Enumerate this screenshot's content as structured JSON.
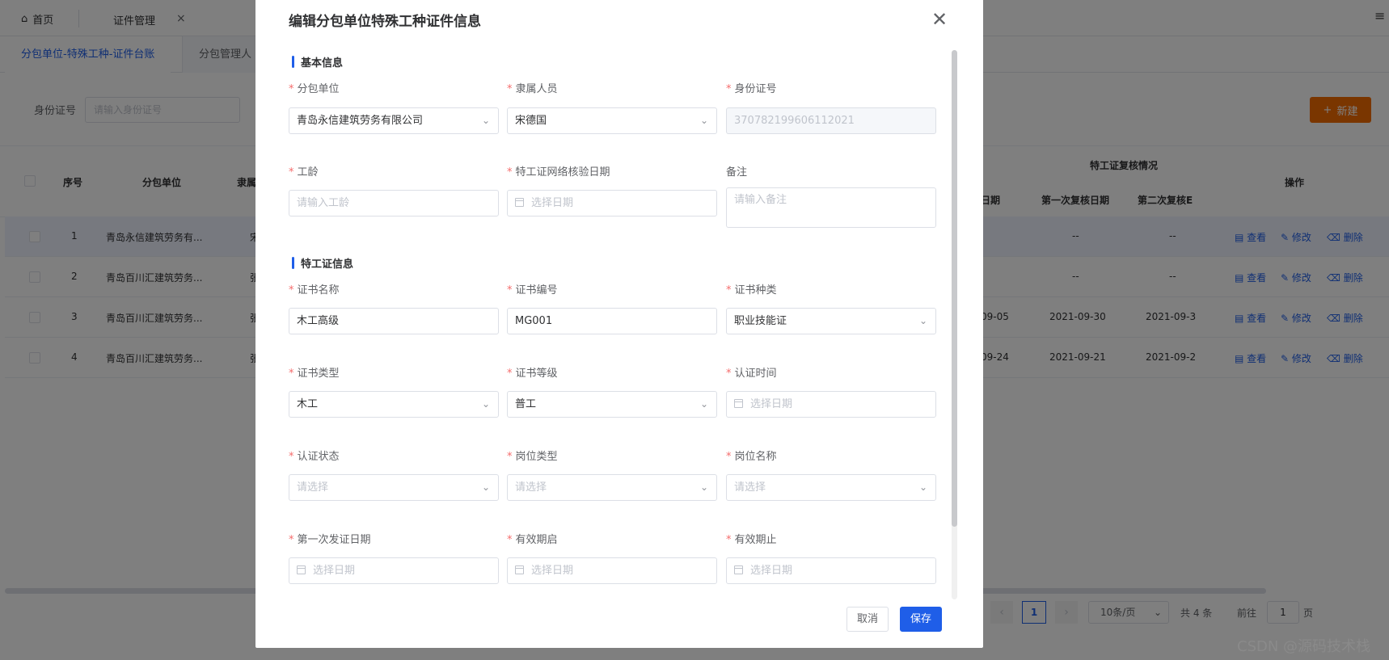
{
  "tabs": {
    "home": "首页",
    "cert_mgmt": "证件管理"
  },
  "subtabs": [
    "分包单位-特殊工种-证件台账",
    "分包管理人"
  ],
  "filter": {
    "label": "身份证号",
    "placeholder": "请输入身份证号"
  },
  "new_button": "新建",
  "table": {
    "headers": {
      "index": "序号",
      "unit": "分包单位",
      "person": "隶属",
      "review_group": "特工证复核情况",
      "date_tail": "日期",
      "first_review": "第一次复核日期",
      "second_review": "第二次复核E",
      "ops": "操作"
    },
    "rows": [
      {
        "index": "1",
        "unit": "青岛永信建筑劳务有...",
        "person": "宋",
        "date": "",
        "first": "--",
        "second": "--"
      },
      {
        "index": "2",
        "unit": "青岛百川汇建筑劳务...",
        "person": "张",
        "date": "",
        "first": "--",
        "second": "--"
      },
      {
        "index": "3",
        "unit": "青岛百川汇建筑劳务...",
        "person": "张",
        "date": "09-05",
        "first": "2021-09-30",
        "second": "2021-09-3"
      },
      {
        "index": "4",
        "unit": "青岛百川汇建筑劳务...",
        "person": "张",
        "date": "09-24",
        "first": "2021-09-21",
        "second": "2021-09-2"
      }
    ],
    "ops": {
      "view": "查看",
      "edit": "修改",
      "delete": "删除"
    }
  },
  "pager": {
    "page": "1",
    "size": "10条/页",
    "total": "共 4 条",
    "goto": "前往",
    "goto_value": "1",
    "page_unit": "页"
  },
  "watermark": "CSDN @源码技术栈",
  "dialog": {
    "title": "编辑分包单位特殊工种证件信息",
    "section_basic": "基本信息",
    "section_cert": "特工证信息",
    "fields": {
      "unit": {
        "label": "分包单位",
        "value": "青岛永信建筑劳务有限公司"
      },
      "person": {
        "label": "隶属人员",
        "value": "宋德国"
      },
      "idcard": {
        "label": "身份证号",
        "value": "370782199606112021"
      },
      "seniority": {
        "label": "工龄",
        "placeholder": "请输入工龄"
      },
      "verify_date": {
        "label": "特工证网络核验日期",
        "placeholder": "选择日期"
      },
      "remark": {
        "label": "备注",
        "placeholder": "请输入备注"
      },
      "cert_name": {
        "label": "证书名称",
        "value": "木工高级"
      },
      "cert_no": {
        "label": "证书编号",
        "value": "MG001"
      },
      "cert_kind": {
        "label": "证书种类",
        "value": "职业技能证"
      },
      "cert_type": {
        "label": "证书类型",
        "value": "木工"
      },
      "cert_level": {
        "label": "证书等级",
        "value": "普工"
      },
      "cert_time": {
        "label": "认证时间",
        "placeholder": "选择日期"
      },
      "cert_status": {
        "label": "认证状态",
        "placeholder": "请选择"
      },
      "post_type": {
        "label": "岗位类型",
        "placeholder": "请选择"
      },
      "post_name": {
        "label": "岗位名称",
        "placeholder": "请选择"
      },
      "first_issue": {
        "label": "第一次发证日期",
        "placeholder": "选择日期"
      },
      "valid_start": {
        "label": "有效期启",
        "placeholder": "选择日期"
      },
      "valid_end": {
        "label": "有效期止",
        "placeholder": "选择日期"
      }
    },
    "cancel": "取消",
    "save": "保存"
  }
}
